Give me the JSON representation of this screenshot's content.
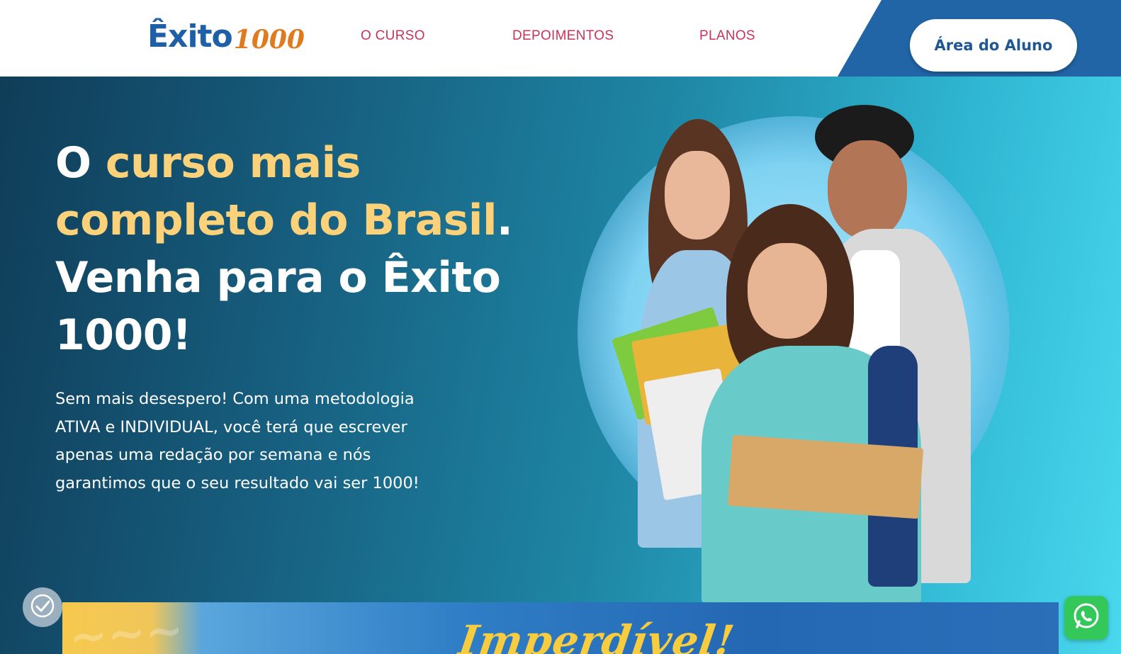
{
  "header": {
    "logo": {
      "word": "Êxito",
      "number": "1000"
    },
    "nav": [
      {
        "label": "O CURSO"
      },
      {
        "label": "DEPOIMENTOS"
      },
      {
        "label": "PLANOS"
      }
    ],
    "student_area_button": "Área do Aluno"
  },
  "hero": {
    "headline": {
      "part1_white": "O ",
      "part2_yellow": "curso mais completo do Brasil",
      "part3_white": ". Venha para o Êxito 1000!"
    },
    "subtext": "Sem mais desespero! Com uma metodologia ATIVA e INDIVIDUAL, você terá que escrever apenas uma redação por semana e nós garantimos que o seu resultado vai ser 1000!"
  },
  "banner": {
    "title": "Imperdível!"
  },
  "colors": {
    "brand_blue": "#1f5fa6",
    "brand_orange": "#e07a1f",
    "nav_red": "#c8335a",
    "highlight_yellow": "#fbd27a",
    "whatsapp_green": "#34c759"
  },
  "icons": {
    "accessibility": "accessibility-toggle-icon",
    "whatsapp": "whatsapp-icon"
  }
}
